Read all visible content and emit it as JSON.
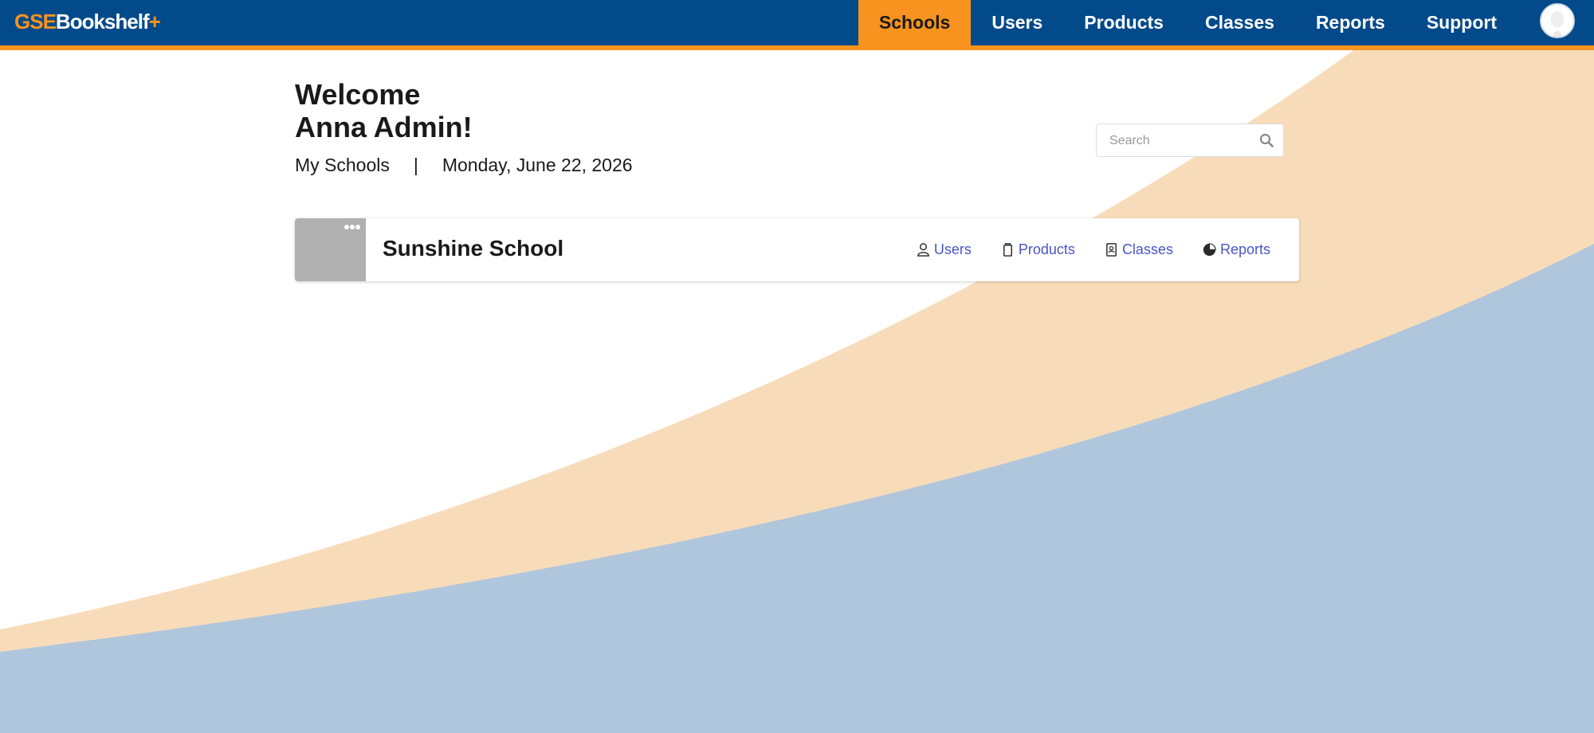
{
  "app": {
    "logo": {
      "part1": "GSE",
      "part2": "Bookshelf",
      "plus": "+"
    }
  },
  "nav": {
    "items": [
      {
        "label": "Schools",
        "active": true
      },
      {
        "label": "Users"
      },
      {
        "label": "Products"
      },
      {
        "label": "Classes"
      },
      {
        "label": "Reports"
      },
      {
        "label": "Support"
      }
    ],
    "avatar_icon": "user-avatar-icon"
  },
  "welcome": {
    "line1": "Welcome",
    "line2": "Anna Admin!",
    "section": "My Schools",
    "separator": "|",
    "date": "Monday, June 22, 2026"
  },
  "search": {
    "placeholder": "Search",
    "icon": "search-icon"
  },
  "schools": [
    {
      "name": "Sunshine School",
      "links": [
        {
          "label": "Users",
          "icon": "user-icon"
        },
        {
          "label": "Products",
          "icon": "product-icon"
        },
        {
          "label": "Classes",
          "icon": "class-icon"
        },
        {
          "label": "Reports",
          "icon": "pie-chart-icon"
        }
      ]
    }
  ],
  "colors": {
    "nav_bg": "#034a8a",
    "accent": "#f7931e",
    "link": "#4a55c5",
    "wave_peach": "#f8dcba",
    "wave_blue": "#b0c6dc"
  }
}
